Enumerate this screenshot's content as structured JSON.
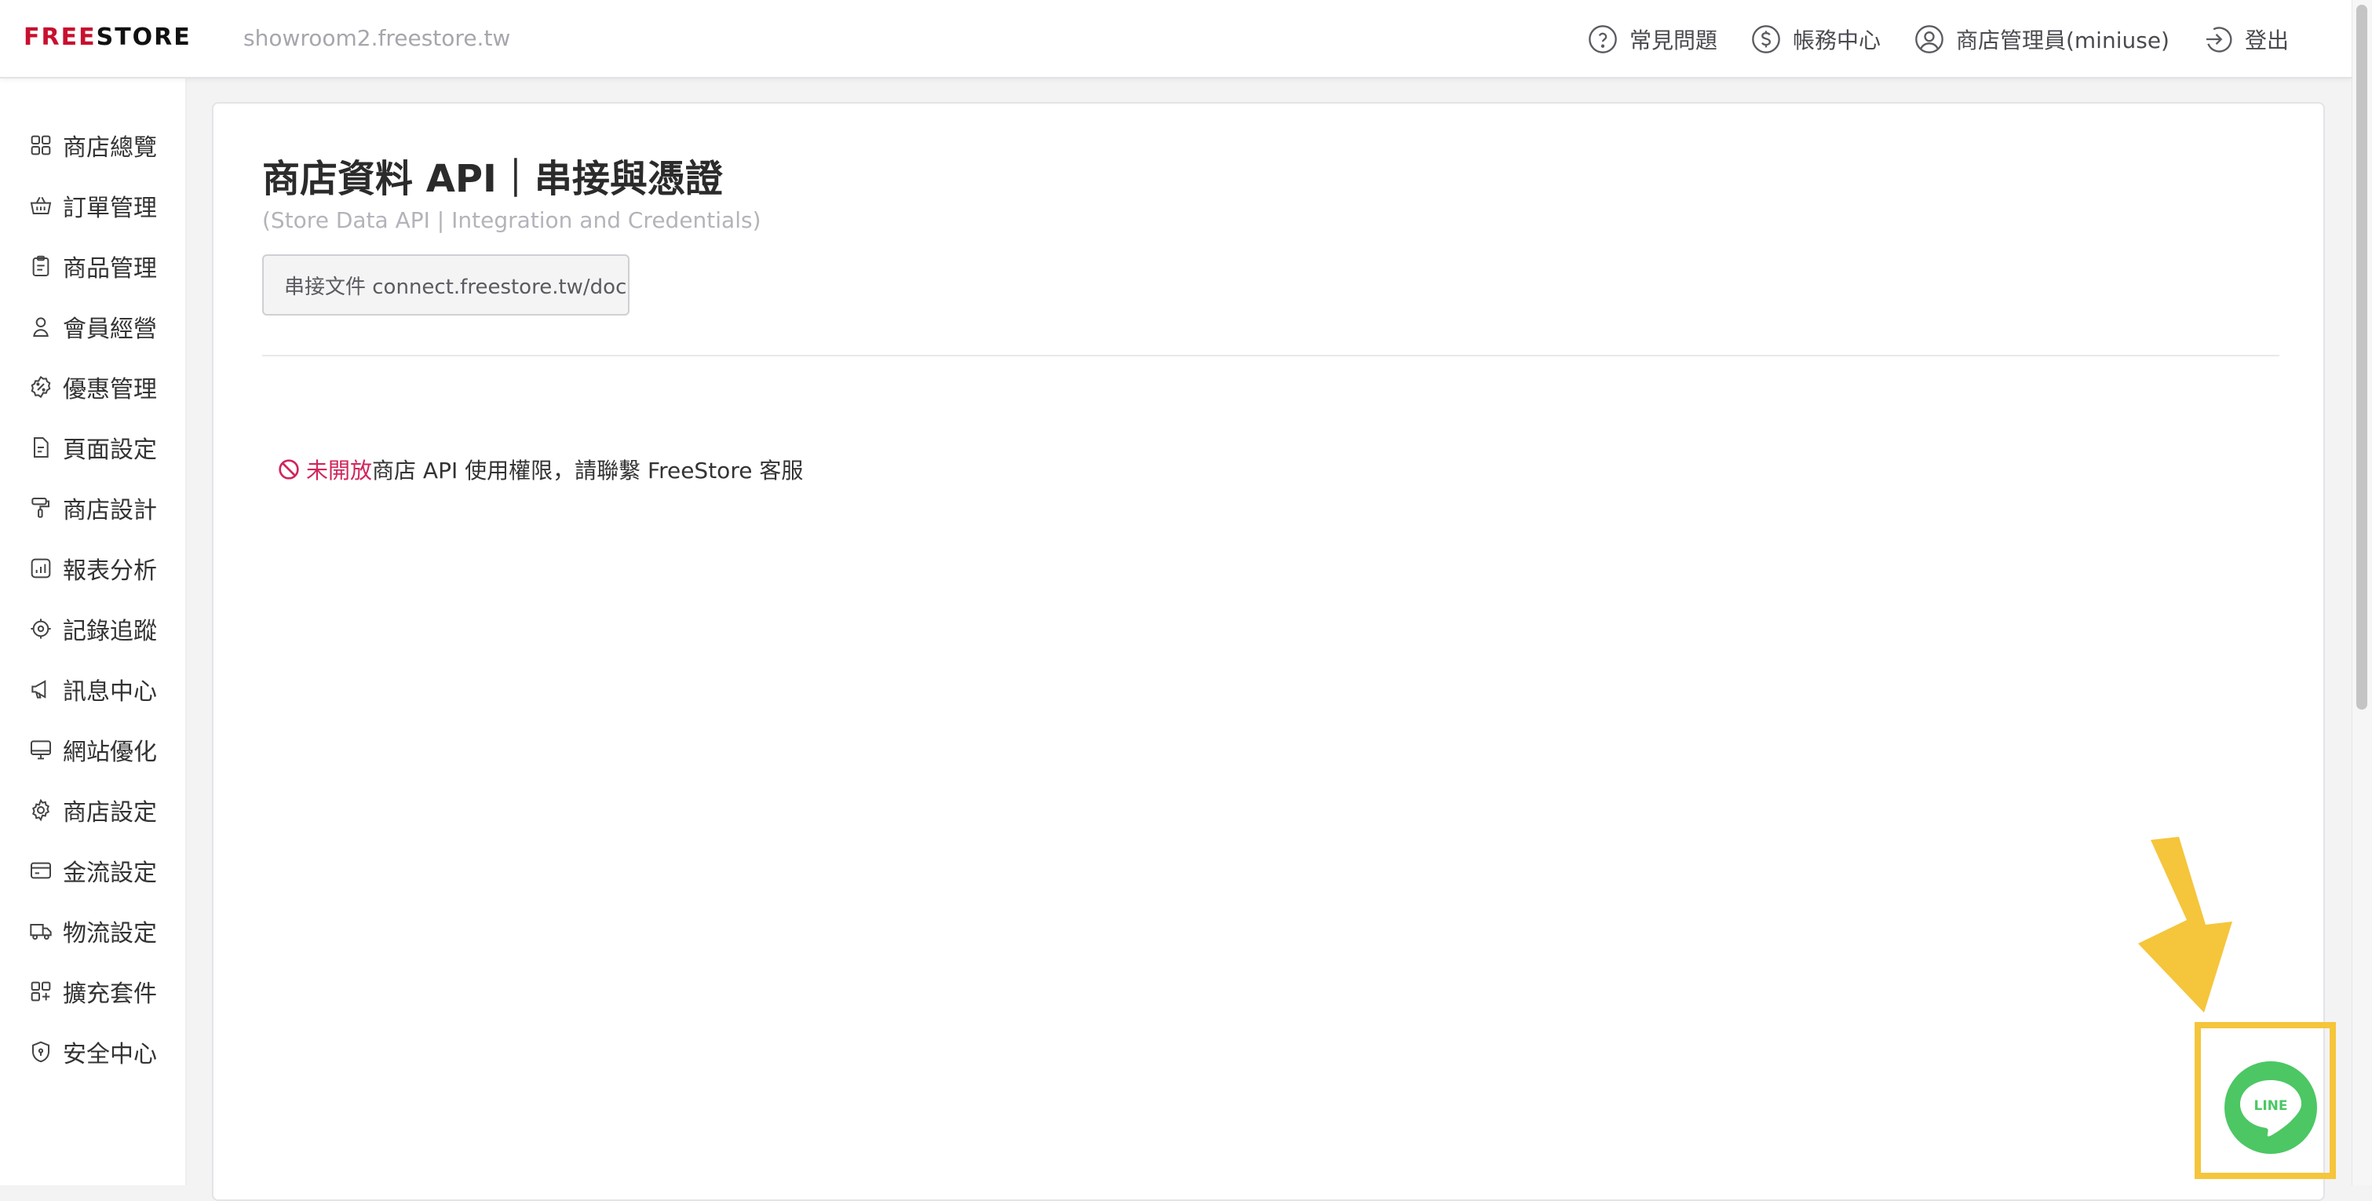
{
  "header": {
    "logo_red": "FREE",
    "logo_black": "STORE",
    "domain": "showroom2.freestore.tw",
    "nav": [
      {
        "label": "常見問題",
        "icon": "question-circle-icon"
      },
      {
        "label": "帳務中心",
        "icon": "dollar-circle-icon"
      },
      {
        "label": "商店管理員(miniuse)",
        "icon": "user-circle-icon"
      },
      {
        "label": "登出",
        "icon": "logout-icon"
      }
    ]
  },
  "sidebar": {
    "items": [
      {
        "label": "商店總覽",
        "icon": "grid-icon"
      },
      {
        "label": "訂單管理",
        "icon": "basket-icon"
      },
      {
        "label": "商品管理",
        "icon": "clipboard-icon"
      },
      {
        "label": "會員經營",
        "icon": "user-icon"
      },
      {
        "label": "優惠管理",
        "icon": "discount-badge-icon"
      },
      {
        "label": "頁面設定",
        "icon": "page-icon"
      },
      {
        "label": "商店設計",
        "icon": "paint-roller-icon"
      },
      {
        "label": "報表分析",
        "icon": "chart-icon"
      },
      {
        "label": "記錄追蹤",
        "icon": "target-icon"
      },
      {
        "label": "訊息中心",
        "icon": "megaphone-icon"
      },
      {
        "label": "網站優化",
        "icon": "monitor-icon"
      },
      {
        "label": "商店設定",
        "icon": "gear-icon"
      },
      {
        "label": "金流設定",
        "icon": "credit-card-icon"
      },
      {
        "label": "物流設定",
        "icon": "truck-icon"
      },
      {
        "label": "擴充套件",
        "icon": "apps-add-icon"
      },
      {
        "label": "安全中心",
        "icon": "shield-icon"
      }
    ]
  },
  "main": {
    "title": "商店資料 API｜串接與憑證",
    "subtitle": "(Store Data API | Integration and Credentials)",
    "doc_button": "串接文件 connect.freestore.tw/doc",
    "notice_highlight": "未開放",
    "notice_text": "商店 API 使用權限，請聯繫 FreeStore 客服"
  },
  "line_button": {
    "label": "LINE",
    "color": "#4cc764"
  },
  "colors": {
    "brand_red": "#c8102e",
    "notice_red": "#d1255a",
    "highlight_yellow": "#f5c53b"
  }
}
